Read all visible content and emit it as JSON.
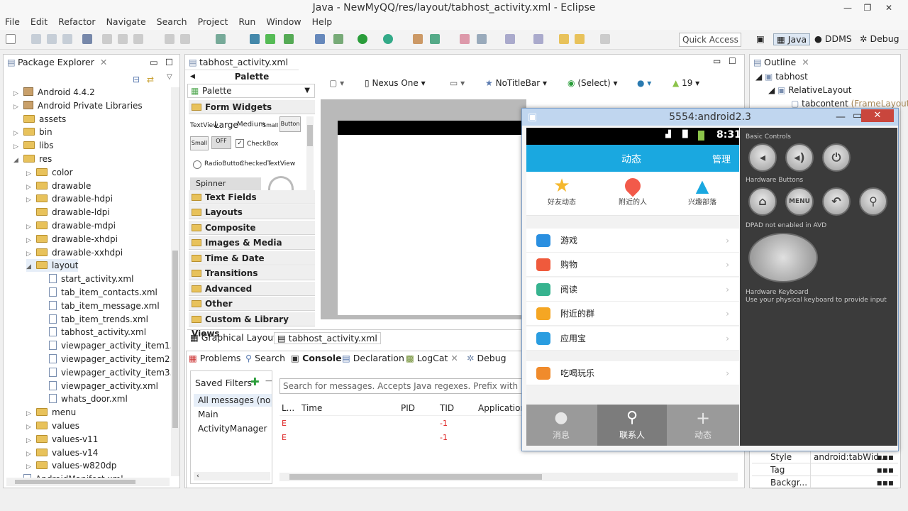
{
  "window": {
    "title": "Java - NewMyQQ/res/layout/tabhost_activity.xml - Eclipse"
  },
  "menu": [
    "File",
    "Edit",
    "Refactor",
    "Navigate",
    "Search",
    "Project",
    "Run",
    "Window",
    "Help"
  ],
  "toolbar": {
    "quick_access": "Quick Access",
    "perspectives": [
      "Java",
      "DDMS",
      "Debug"
    ]
  },
  "package_explorer": {
    "title": "Package Explorer",
    "items": [
      {
        "label": "Android 4.4.2",
        "kind": "jar",
        "indent": 1,
        "arrow": "▷"
      },
      {
        "label": "Android Private Libraries",
        "kind": "jar",
        "indent": 1,
        "arrow": "▷"
      },
      {
        "label": "assets",
        "kind": "folder",
        "indent": 1,
        "arrow": ""
      },
      {
        "label": "bin",
        "kind": "folder",
        "indent": 1,
        "arrow": "▷"
      },
      {
        "label": "libs",
        "kind": "folder",
        "indent": 1,
        "arrow": "▷"
      },
      {
        "label": "res",
        "kind": "folder",
        "indent": 1,
        "arrow": "◢"
      },
      {
        "label": "color",
        "kind": "folder",
        "indent": 2,
        "arrow": "▷"
      },
      {
        "label": "drawable",
        "kind": "folder",
        "indent": 2,
        "arrow": "▷"
      },
      {
        "label": "drawable-hdpi",
        "kind": "folder",
        "indent": 2,
        "arrow": "▷"
      },
      {
        "label": "drawable-ldpi",
        "kind": "folder",
        "indent": 2,
        "arrow": ""
      },
      {
        "label": "drawable-mdpi",
        "kind": "folder",
        "indent": 2,
        "arrow": "▷"
      },
      {
        "label": "drawable-xhdpi",
        "kind": "folder",
        "indent": 2,
        "arrow": "▷"
      },
      {
        "label": "drawable-xxhdpi",
        "kind": "folder",
        "indent": 2,
        "arrow": "▷"
      },
      {
        "label": "layout",
        "kind": "folder",
        "indent": 2,
        "arrow": "◢"
      },
      {
        "label": "start_activity.xml",
        "kind": "xml",
        "indent": 3,
        "arrow": ""
      },
      {
        "label": "tab_item_contacts.xml",
        "kind": "xml",
        "indent": 3,
        "arrow": ""
      },
      {
        "label": "tab_item_message.xml",
        "kind": "xml",
        "indent": 3,
        "arrow": ""
      },
      {
        "label": "tab_item_trends.xml",
        "kind": "xml",
        "indent": 3,
        "arrow": ""
      },
      {
        "label": "tabhost_activity.xml",
        "kind": "xml",
        "indent": 3,
        "arrow": ""
      },
      {
        "label": "viewpager_activity_item1.x",
        "kind": "xml",
        "indent": 3,
        "arrow": ""
      },
      {
        "label": "viewpager_activity_item2.x",
        "kind": "xml",
        "indent": 3,
        "arrow": ""
      },
      {
        "label": "viewpager_activity_item3.x",
        "kind": "xml",
        "indent": 3,
        "arrow": ""
      },
      {
        "label": "viewpager_activity.xml",
        "kind": "xml",
        "indent": 3,
        "arrow": ""
      },
      {
        "label": "whats_door.xml",
        "kind": "xml",
        "indent": 3,
        "arrow": ""
      },
      {
        "label": "menu",
        "kind": "folder",
        "indent": 2,
        "arrow": "▷"
      },
      {
        "label": "values",
        "kind": "folder",
        "indent": 2,
        "arrow": "▷"
      },
      {
        "label": "values-v11",
        "kind": "folder",
        "indent": 2,
        "arrow": "▷"
      },
      {
        "label": "values-v14",
        "kind": "folder",
        "indent": 2,
        "arrow": "▷"
      },
      {
        "label": "values-w820dp",
        "kind": "folder",
        "indent": 2,
        "arrow": "▷"
      },
      {
        "label": "AndroidManifest.xml",
        "kind": "xml",
        "indent": 1,
        "arrow": ""
      }
    ]
  },
  "editor": {
    "tab": "tabhost_activity.xml",
    "palette_header": "Palette",
    "palette_dropdown": "Palette",
    "categories": [
      "Form Widgets",
      "Text Fields",
      "Layouts",
      "Composite",
      "Images & Media",
      "Time & Date",
      "Transitions",
      "Advanced",
      "Other",
      "Custom & Library Views"
    ],
    "widgets": {
      "textview": "TextView",
      "large": "Large",
      "medium": "Medium",
      "small": "Small",
      "button": "Button",
      "small_btn": "Small",
      "off": "OFF",
      "checkbox": "CheckBox",
      "radio": "RadioButton",
      "checked_textview": "CheckedTextView",
      "spinner": "Spinner"
    },
    "config": {
      "device": "Nexus One",
      "theme": "NoTitleBar",
      "activity": "(Select)",
      "api": "19"
    },
    "bottom_tabs": [
      "Graphical Layout",
      "tabhost_activity.xml"
    ]
  },
  "bottom_panel": {
    "tabs": [
      "Problems",
      "Search",
      "Console",
      "Declaration",
      "LogCat",
      "Debug"
    ],
    "saved_filters": "Saved Filters",
    "filters": [
      "All messages (no f",
      "Main",
      "ActivityManager"
    ],
    "search_placeholder": "Search for messages. Accepts Java regexes. Prefix with pid:, a",
    "columns": [
      "L...",
      "Time",
      "PID",
      "TID",
      "Application"
    ],
    "rows": [
      {
        "level": "E",
        "tid": "-1"
      },
      {
        "level": "E",
        "tid": "-1"
      }
    ]
  },
  "outline": {
    "title": "Outline",
    "nodes": [
      "tabhost",
      "RelativeLayout",
      "tabcontent"
    ],
    "frame_hint": "(FrameLayout)",
    "props": [
      {
        "name": "Style",
        "value": "android:tabWid..."
      },
      {
        "name": "Tag",
        "value": ""
      },
      {
        "name": "Backgr...",
        "value": ""
      }
    ]
  },
  "emulator": {
    "title": "5554:android2.3",
    "time": "8:31",
    "header": {
      "title": "动态",
      "action": "管理"
    },
    "top_icons": [
      "好友动态",
      "附近的人",
      "兴趣部落"
    ],
    "list": [
      {
        "label": "游戏",
        "color": "#2a8fe0"
      },
      {
        "label": "购物",
        "color": "#ef5a3c"
      },
      {
        "label": "阅读",
        "color": "#37b38f"
      },
      {
        "label": "附近的群",
        "color": "#f5a623"
      },
      {
        "label": "应用宝",
        "color": "#2a9de0"
      },
      {
        "label": "吃喝玩乐",
        "color": "#f08b2c"
      }
    ],
    "tabs": [
      "消息",
      "联系人",
      "动态"
    ],
    "skin": {
      "basic_controls": "Basic Controls",
      "hardware_buttons": "Hardware Buttons",
      "menu": "MENU",
      "dpad": "DPAD not enabled in AVD",
      "keyboard_title": "Hardware Keyboard",
      "keyboard_hint": "Use your physical keyboard to provide input"
    }
  }
}
